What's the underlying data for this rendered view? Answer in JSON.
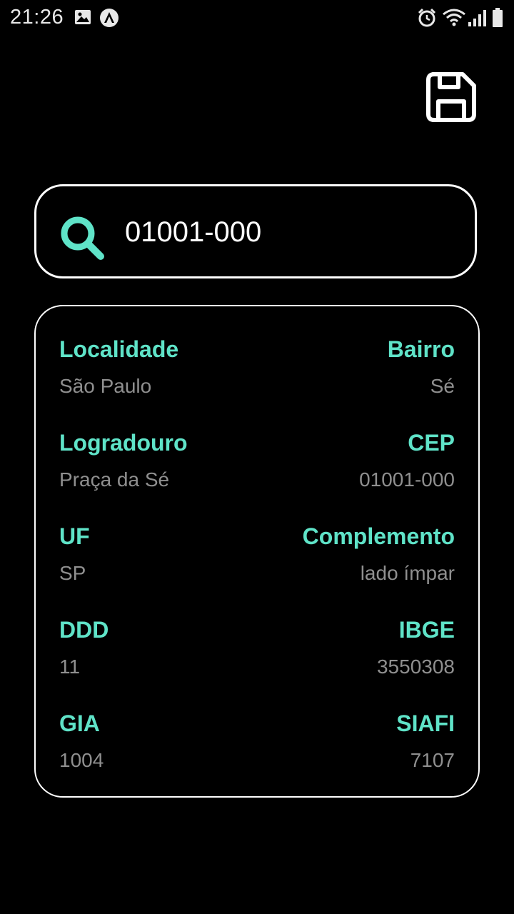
{
  "status_bar": {
    "time": "21:26",
    "left_icons": [
      "image-icon",
      "app-notification-icon"
    ],
    "right_icons": [
      "alarm-icon",
      "wifi-icon",
      "signal-icon",
      "battery-icon"
    ]
  },
  "toolbar": {
    "save_icon": "save-icon"
  },
  "search": {
    "value": "01001-000",
    "icon": "search-icon"
  },
  "colors": {
    "accent": "#5fe3c8",
    "background": "#000000",
    "value_text": "#8f8f8f",
    "border": "#ffffff"
  },
  "result": {
    "localidade": {
      "label": "Localidade",
      "value": "São Paulo"
    },
    "bairro": {
      "label": "Bairro",
      "value": "Sé"
    },
    "logradouro": {
      "label": "Logradouro",
      "value": "Praça da Sé"
    },
    "cep": {
      "label": "CEP",
      "value": "01001-000"
    },
    "uf": {
      "label": "UF",
      "value": "SP"
    },
    "complemento": {
      "label": "Complemento",
      "value": "lado ímpar"
    },
    "ddd": {
      "label": "DDD",
      "value": "11"
    },
    "ibge": {
      "label": "IBGE",
      "value": "3550308"
    },
    "gia": {
      "label": "GIA",
      "value": "1004"
    },
    "siafi": {
      "label": "SIAFI",
      "value": "7107"
    }
  }
}
